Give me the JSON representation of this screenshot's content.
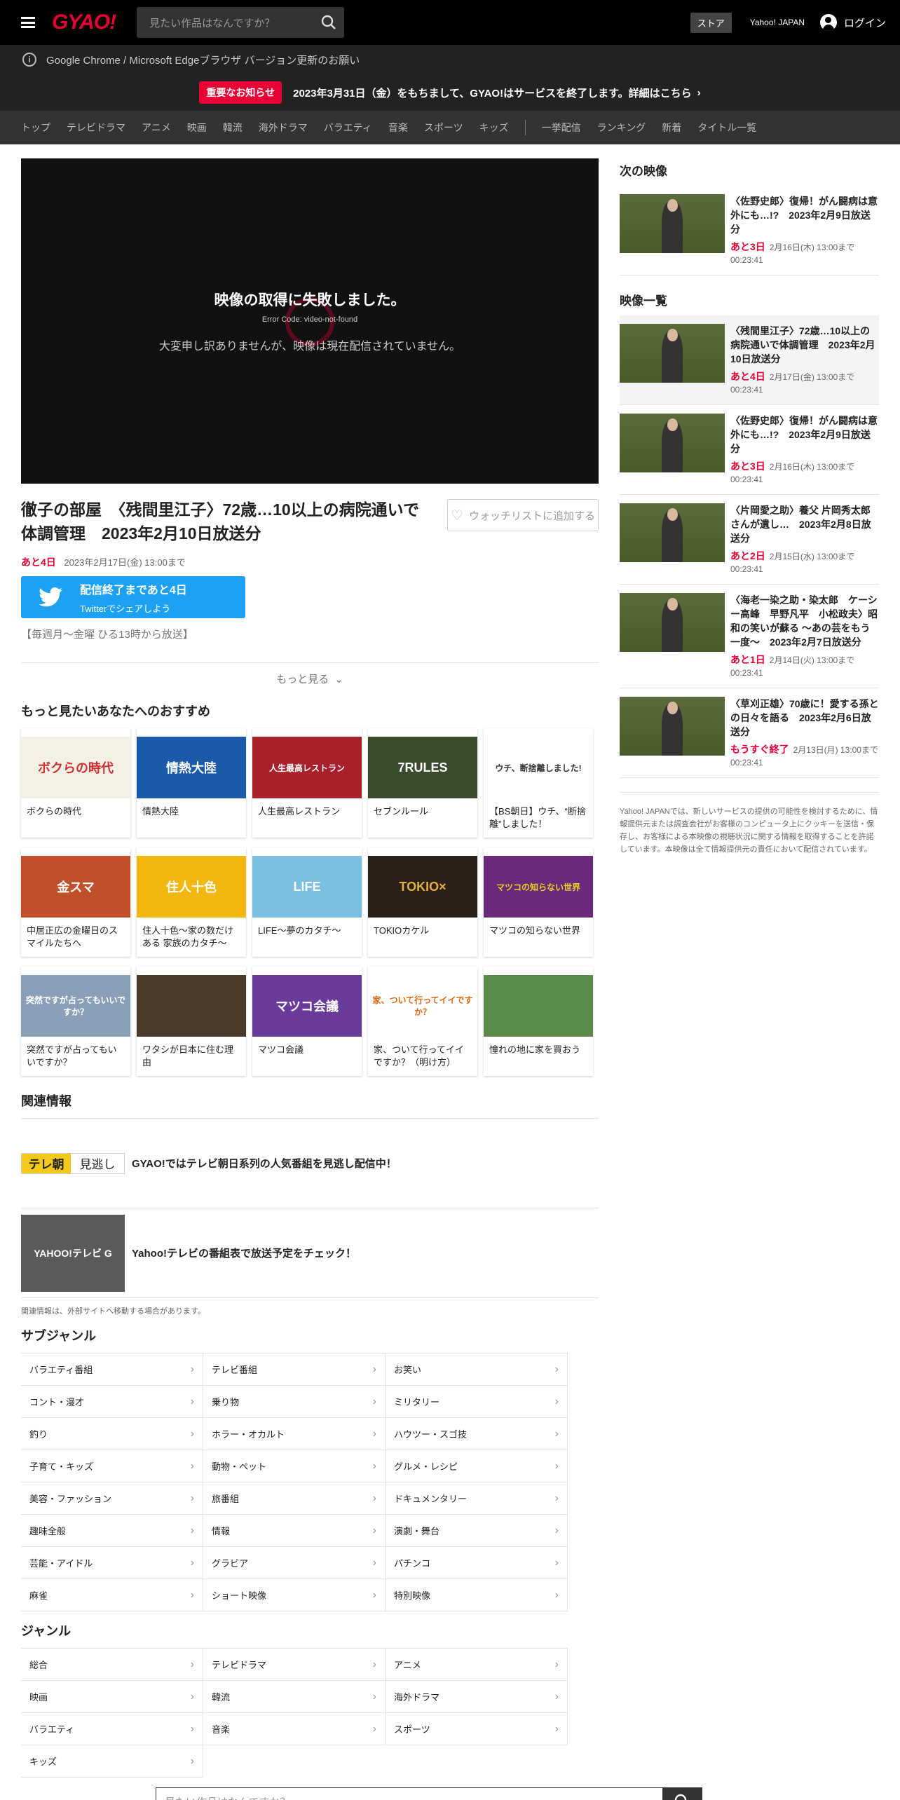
{
  "header": {
    "logo": "GYAO!",
    "search_placeholder": "見たい作品はなんですか？",
    "store": "ストア",
    "yahoo_japan": "Yahoo! JAPAN",
    "login": "ログイン"
  },
  "browser_notice": "Google Chrome / Microsoft Edgeブラウザ バージョン更新のお願い",
  "important": {
    "badge": "重要なお知らせ",
    "text": "2023年3月31日（金）をもちまして、GYAO!はサービスを終了します。詳細はこちら"
  },
  "nav": {
    "items": [
      "トップ",
      "テレビドラマ",
      "アニメ",
      "映画",
      "韓流",
      "海外ドラマ",
      "バラエティ",
      "音楽",
      "スポーツ",
      "キッズ"
    ],
    "items2": [
      "一挙配信",
      "ランキング",
      "新着",
      "タイトル一覧"
    ]
  },
  "player": {
    "error": "映像の取得に失敗しました。",
    "code": "Error Code: video-not-found",
    "message": "大変申し訳ありませんが、映像は現在配信されていません。"
  },
  "video": {
    "title": "徹子の部屋　〈残間里江子〉72歳…10以上の病院通いで体調管理　2023年2月10日放送分",
    "watchlist": "ウォッチリストに追加する",
    "remaining": "あと4日",
    "until": "2023年2月17日(金) 13:00まで",
    "twitter_line1": "配信終了まであと4日",
    "twitter_line2": "Twitterでシェアしよう",
    "schedule": "【毎週月～金曜 ひる13時から放送】",
    "more": "もっと見る"
  },
  "recs": {
    "title": "もっと見たいあなたへのおすすめ",
    "items": [
      {
        "label": "ボクらの時代",
        "thumb": "ボクらの時代",
        "bg": "#f3f0e8",
        "fg": "#d03030"
      },
      {
        "label": "情熱大陸",
        "thumb": "情熱大陸",
        "bg": "#1a5aa8",
        "fg": "#ffffff"
      },
      {
        "label": "人生最高レストラン",
        "thumb": "人生最高レストラン",
        "bg": "#a8202a",
        "fg": "#ffffff"
      },
      {
        "label": "セブンルール",
        "thumb": "7RULES",
        "bg": "#3a4a2a",
        "fg": "#ffffff"
      },
      {
        "label": "【BS朝日】ウチ、“断捨離”しました！",
        "thumb": "ウチ、断捨離しました!",
        "bg": "#ffffff",
        "fg": "#333333"
      },
      {
        "label": "中居正広の金曜日のスマイルたちへ",
        "thumb": "金スマ",
        "bg": "#c0502a",
        "fg": "#ffffff"
      },
      {
        "label": "住人十色～家の数だけある 家族のカタチ～",
        "thumb": "住人十色",
        "bg": "#f2b810",
        "fg": "#ffffff"
      },
      {
        "label": "LIFE～夢のカタチ～",
        "thumb": "LIFE",
        "bg": "#7ac0e0",
        "fg": "#ffffff"
      },
      {
        "label": "TOKIOカケル",
        "thumb": "TOKIO×",
        "bg": "#2a2018",
        "fg": "#e0b040"
      },
      {
        "label": "マツコの知らない世界",
        "thumb": "マツコの知らない世界",
        "bg": "#6a2a7a",
        "fg": "#f2d020"
      },
      {
        "label": "突然ですが占ってもいいですか？",
        "thumb": "突然ですが占ってもいいですか？",
        "bg": "#8aa0b8",
        "fg": "#ffffff"
      },
      {
        "label": "ワタシが日本に住む理由",
        "thumb": "",
        "bg": "#4a3a2a",
        "fg": "#ffffff"
      },
      {
        "label": "マツコ会議",
        "thumb": "マツコ会議",
        "bg": "#6a3a9a",
        "fg": "#ffffff"
      },
      {
        "label": "家、ついて行ってイイですか？（明け方）",
        "thumb": "家、ついて行ってイイですか？",
        "bg": "#ffffff",
        "fg": "#e06a10"
      },
      {
        "label": "憧れの地に家を買おう",
        "thumb": "",
        "bg": "#5a8a4a",
        "fg": "#ffffff"
      }
    ]
  },
  "related": {
    "title": "関連情報",
    "items": [
      {
        "text": "GYAO!ではテレビ朝日系列の人気番組を見逃し配信中！",
        "thumb": "テレ朝 見逃し"
      },
      {
        "text": "Yahoo!テレビの番組表で放送予定をチェック！",
        "thumb": "YAHOO!テレビ G"
      }
    ],
    "note": "関連情報は、外部サイトへ移動する場合があります。"
  },
  "subgenre": {
    "title": "サブジャンル",
    "items": [
      "バラエティ番組",
      "テレビ番組",
      "お笑い",
      "コント・漫才",
      "乗り物",
      "ミリタリー",
      "釣り",
      "ホラー・オカルト",
      "ハウツー・スゴ技",
      "子育て・キッズ",
      "動物・ペット",
      "グルメ・レシピ",
      "美容・ファッション",
      "旅番組",
      "ドキュメンタリー",
      "趣味全般",
      "情報",
      "演劇・舞台",
      "芸能・アイドル",
      "グラビア",
      "パチンコ",
      "麻雀",
      "ショート映像",
      "特別映像"
    ]
  },
  "genre": {
    "title": "ジャンル",
    "items": [
      "総合",
      "テレビドラマ",
      "アニメ",
      "映画",
      "韓流",
      "海外ドラマ",
      "バラエティ",
      "音楽",
      "スポーツ",
      "キッズ"
    ]
  },
  "bottom_search_placeholder": "見たい作品はなんですか？",
  "side": {
    "next_title": "次の映像",
    "next": {
      "title": "〈佐野史郎〉復帰！がん闘病は意外にも…!?　2023年2月9日放送分",
      "remaining": "あと3日",
      "until": "2月16日(木) 13:00まで",
      "duration": "00:23:41"
    },
    "list_title": "映像一覧",
    "list": [
      {
        "title": "〈残間里江子〉72歳…10以上の病院通いで体調管理　2023年2月10日放送分",
        "remaining": "あと4日",
        "until": "2月17日(金) 13:00まで",
        "duration": "00:23:41",
        "active": true
      },
      {
        "title": "〈佐野史郎〉復帰！がん闘病は意外にも…!?　2023年2月9日放送分",
        "remaining": "あと3日",
        "until": "2月16日(木) 13:00まで",
        "duration": "00:23:41"
      },
      {
        "title": "〈片岡愛之助〉養父 片岡秀太郎さんが遺し…　2023年2月8日放送分",
        "remaining": "あと2日",
        "until": "2月15日(水) 13:00まで",
        "duration": "00:23:41"
      },
      {
        "title": "〈海老一染之助・染太郎　ケーシー高峰　早野凡平　小松政夫〉昭和の笑いが蘇る ～あの芸をもう一度～　2023年2月7日放送分",
        "remaining": "あと1日",
        "until": "2月14日(火) 13:00まで",
        "duration": "00:23:41"
      },
      {
        "title": "〈草刈正雄〉70歳に！愛する孫との日々を語る　2023年2月6日放送分",
        "remaining": "もうすぐ終了",
        "until": "2月13日(月) 13:00まで",
        "duration": "00:23:41"
      }
    ],
    "note": "Yahoo! JAPANでは、新しいサービスの提供の可能性を検討するために、情報提供元または調査会社がお客様のコンピュータ上にクッキーを送信・保存し、お客様による本映像の視聴状況に関する情報を取得することを許諾しています。本映像は全て情報提供元の責任において配信されています。"
  }
}
